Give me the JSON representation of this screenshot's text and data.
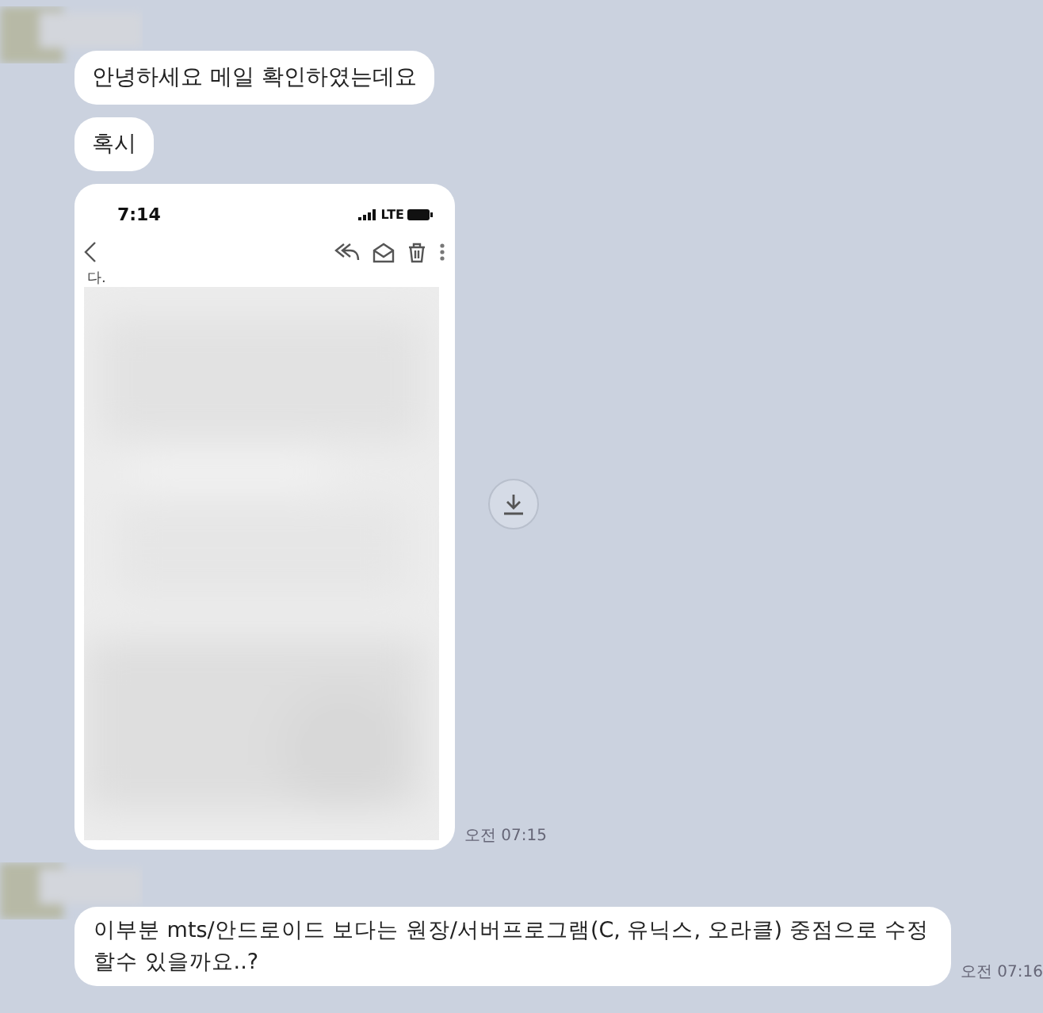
{
  "messages": [
    {
      "kind": "avatar"
    },
    {
      "kind": "text",
      "text": "안녕하세요 메일 확인하였는데요"
    },
    {
      "kind": "text",
      "text": "혹시"
    },
    {
      "phone": {
        "clock": "7:14",
        "network": "LTE",
        "snippet": "다."
      },
      "time": "오전 07:15"
    },
    {
      "kind": "avatar"
    },
    {
      "kind": "text",
      "text": "이부분 mts/안드로이드 보다는 원장/서버프로그램(C, 유닉스, 오라클) 중점으로 수정할수 있을까요..?",
      "time": "오전 07:16"
    }
  ]
}
